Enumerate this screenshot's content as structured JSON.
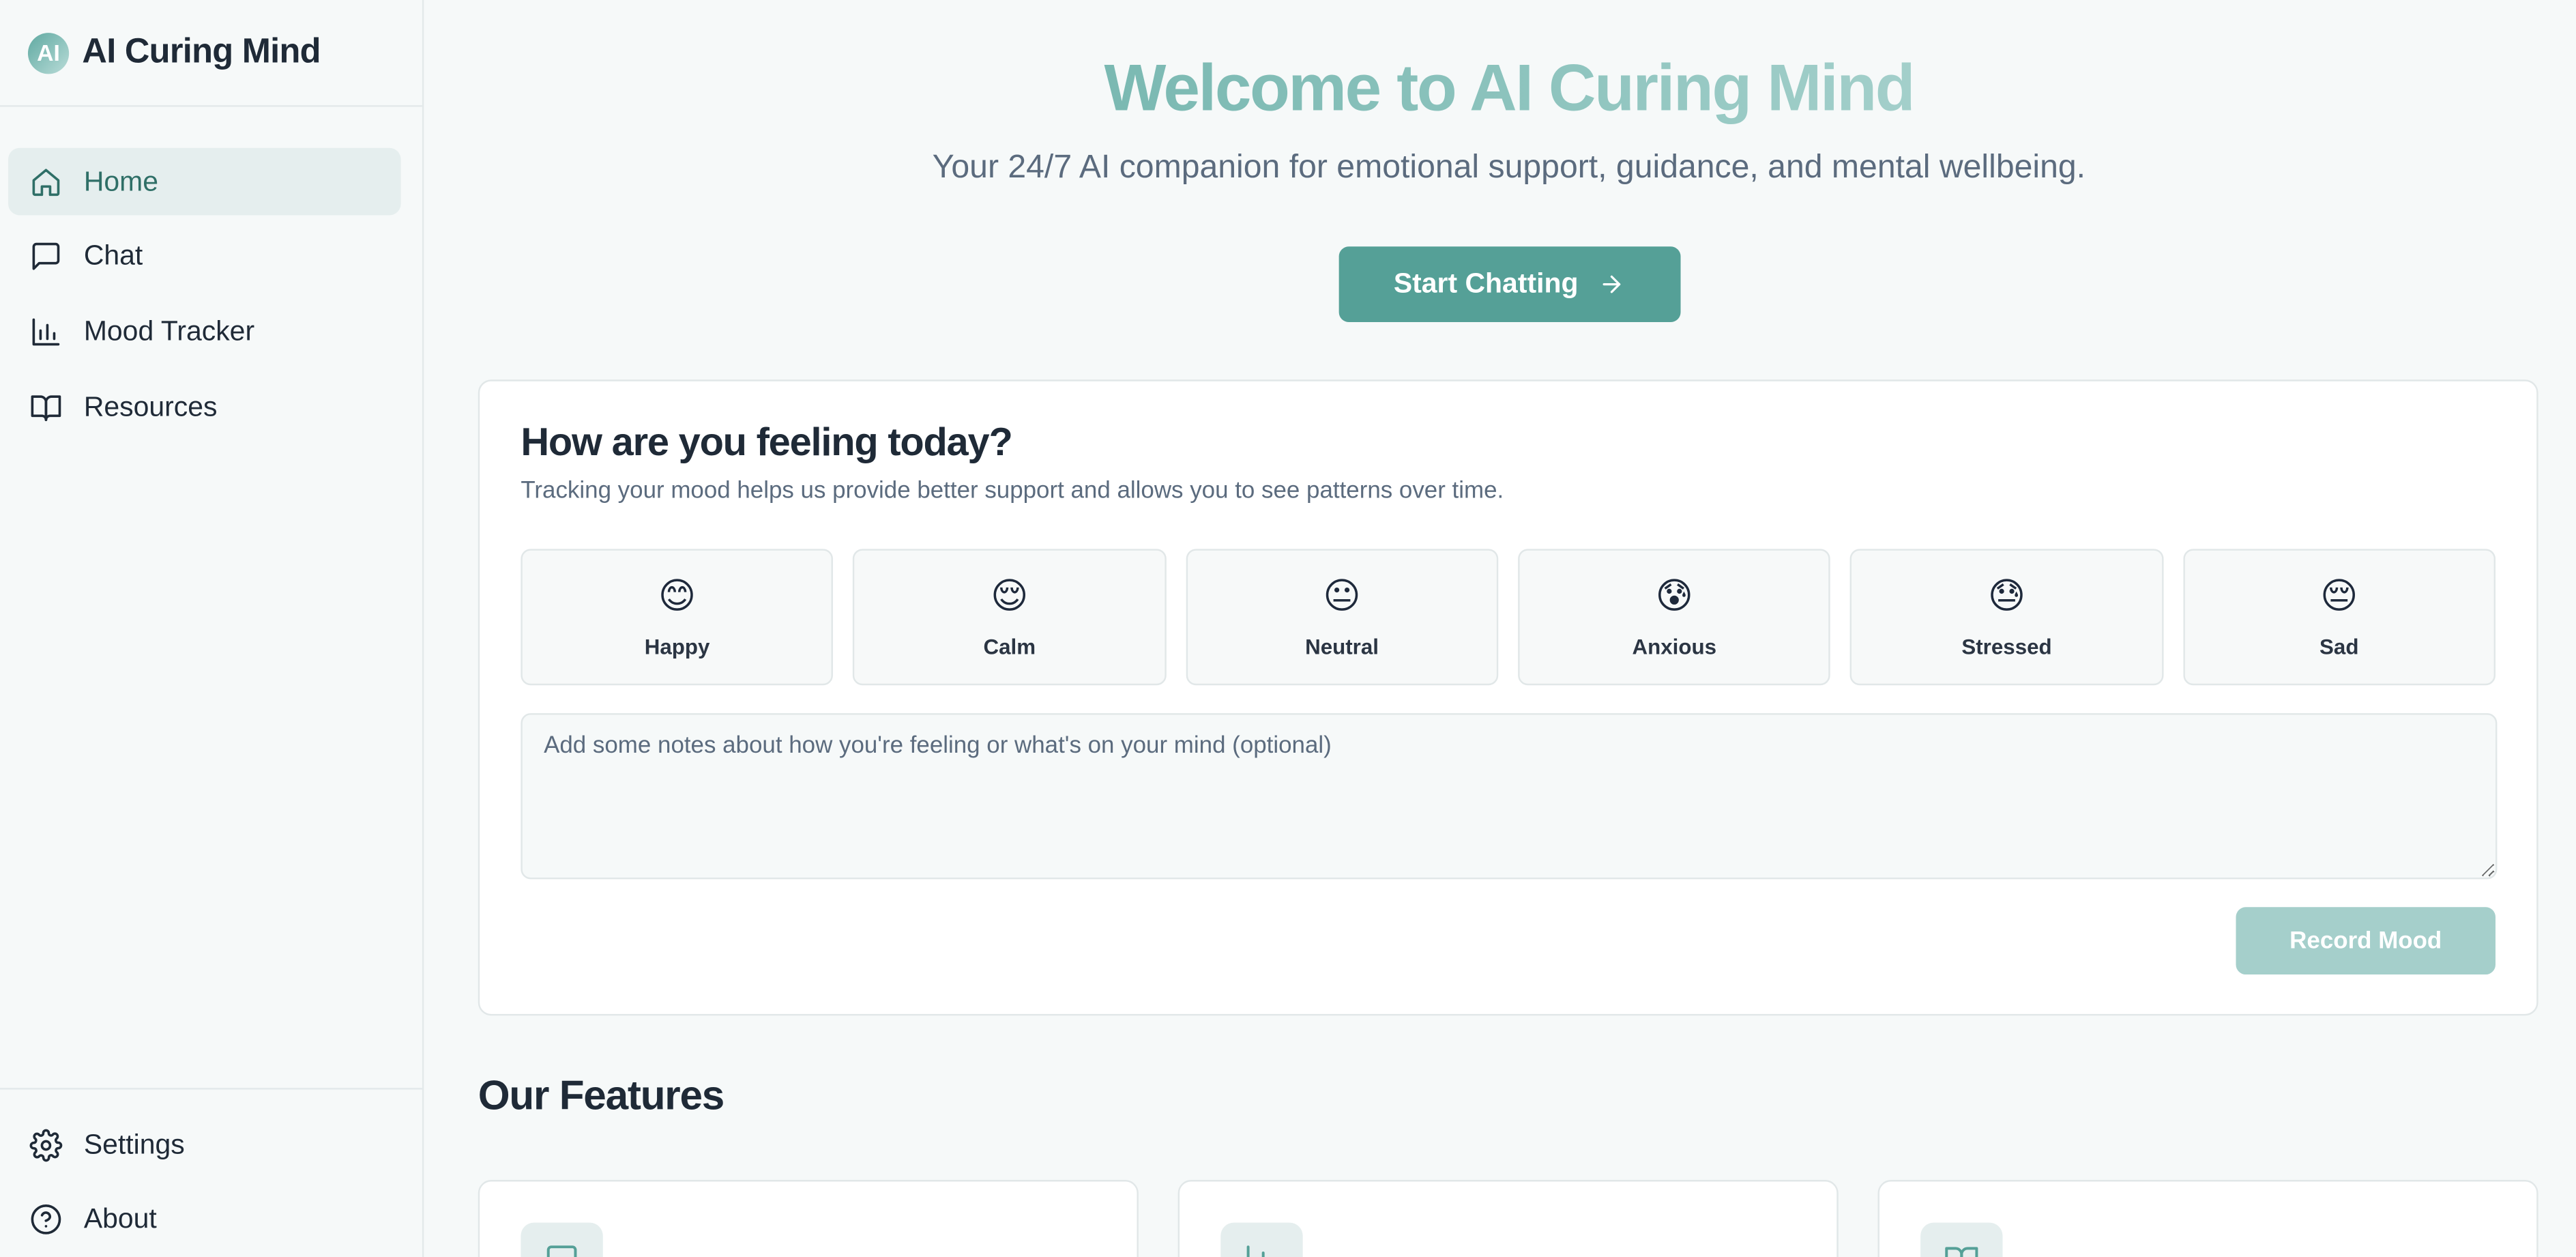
{
  "app": {
    "logo_text": "AI",
    "name": "AI Curing Mind"
  },
  "sidebar": {
    "items": [
      {
        "label": "Home",
        "icon": "home-icon",
        "active": true
      },
      {
        "label": "Chat",
        "icon": "chat-icon",
        "active": false
      },
      {
        "label": "Mood Tracker",
        "icon": "bar-chart-icon",
        "active": false
      },
      {
        "label": "Resources",
        "icon": "book-icon",
        "active": false
      }
    ],
    "bottom_items": [
      {
        "label": "Settings",
        "icon": "gear-icon"
      },
      {
        "label": "About",
        "icon": "help-circle-icon"
      }
    ]
  },
  "hero": {
    "title": "Welcome to AI Curing Mind",
    "subtitle": "Your 24/7 AI companion for emotional support, guidance, and mental wellbeing.",
    "cta_label": "Start Chatting",
    "cta_icon": "arrow-right-icon"
  },
  "mood_card": {
    "title": "How are you feeling today?",
    "description": "Tracking your mood helps us provide better support and allows you to see patterns over time.",
    "moods": [
      {
        "emoji": "😊",
        "label": "Happy"
      },
      {
        "emoji": "😌",
        "label": "Calm"
      },
      {
        "emoji": "😐",
        "label": "Neutral"
      },
      {
        "emoji": "😰",
        "label": "Anxious"
      },
      {
        "emoji": "😓",
        "label": "Stressed"
      },
      {
        "emoji": "😔",
        "label": "Sad"
      }
    ],
    "notes_placeholder": "Add some notes about how you're feeling or what's on your mind (optional)",
    "record_label": "Record Mood"
  },
  "features": {
    "title": "Our Features",
    "cards": [
      {
        "icon": "chat-icon"
      },
      {
        "icon": "bar-chart-icon"
      },
      {
        "icon": "book-icon"
      }
    ]
  },
  "colors": {
    "accent": "#55a097",
    "accent_light": "#a5cfcb",
    "active_bg": "#e5eeee",
    "text_dark": "#1f2a37",
    "text_muted": "#5b6b7e"
  }
}
